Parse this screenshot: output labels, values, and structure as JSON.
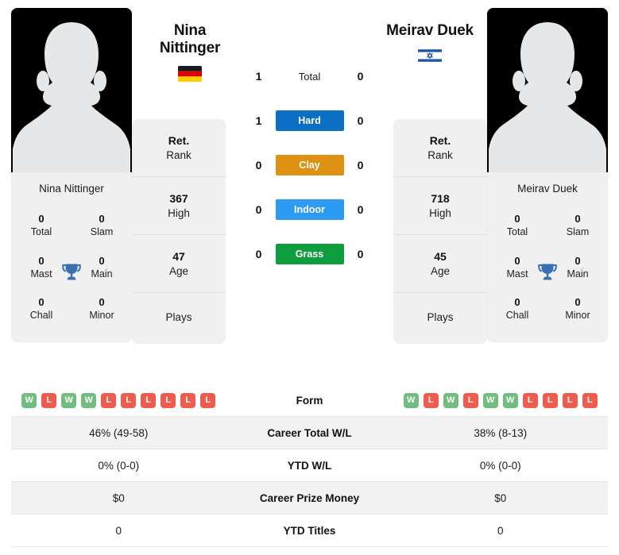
{
  "players": {
    "left": {
      "name_line1": "Nina",
      "name_line2": "Nittinger",
      "full_name": "Nina Nittinger",
      "country": "Germany",
      "flag_icon": "flag-germany",
      "rank": "Ret.",
      "rank_label": "Rank",
      "high": "367",
      "high_label": "High",
      "age": "47",
      "age_label": "Age",
      "plays": "Plays",
      "titles": {
        "total": "0",
        "total_label": "Total",
        "slam": "0",
        "slam_label": "Slam",
        "mast": "0",
        "mast_label": "Mast",
        "main": "0",
        "main_label": "Main",
        "chall": "0",
        "chall_label": "Chall",
        "minor": "0",
        "minor_label": "Minor"
      },
      "form": [
        "W",
        "L",
        "W",
        "W",
        "L",
        "L",
        "L",
        "L",
        "L",
        "L"
      ],
      "career_total_wl": "46% (49-58)",
      "ytd_wl": "0% (0-0)",
      "career_prize_money": "$0",
      "ytd_titles": "0",
      "surface_scores": {
        "total": "1",
        "hard": "1",
        "clay": "0",
        "indoor": "0",
        "grass": "0"
      }
    },
    "right": {
      "name_line1": "Meirav Duek",
      "name_line2": "",
      "full_name": "Meirav Duek",
      "country": "Israel",
      "flag_icon": "flag-israel",
      "rank": "Ret.",
      "rank_label": "Rank",
      "high": "718",
      "high_label": "High",
      "age": "45",
      "age_label": "Age",
      "plays": "Plays",
      "titles": {
        "total": "0",
        "total_label": "Total",
        "slam": "0",
        "slam_label": "Slam",
        "mast": "0",
        "mast_label": "Mast",
        "main": "0",
        "main_label": "Main",
        "chall": "0",
        "chall_label": "Chall",
        "minor": "0",
        "minor_label": "Minor"
      },
      "form": [
        "W",
        "L",
        "W",
        "L",
        "W",
        "W",
        "L",
        "L",
        "L",
        "L"
      ],
      "career_total_wl": "38% (8-13)",
      "ytd_wl": "0% (0-0)",
      "career_prize_money": "$0",
      "ytd_titles": "0",
      "surface_scores": {
        "total": "0",
        "hard": "0",
        "clay": "0",
        "indoor": "0",
        "grass": "0"
      }
    }
  },
  "surfaces": [
    {
      "key": "total",
      "label": "Total",
      "color": "transparent",
      "plain": true
    },
    {
      "key": "hard",
      "label": "Hard",
      "color": "#0d6fc4",
      "plain": false
    },
    {
      "key": "clay",
      "label": "Clay",
      "color": "#df9113",
      "plain": false
    },
    {
      "key": "indoor",
      "label": "Indoor",
      "color": "#2b9bf4",
      "plain": false
    },
    {
      "key": "grass",
      "label": "Grass",
      "color": "#0e9e3e",
      "plain": false
    }
  ],
  "table_rows": [
    {
      "label": "Form"
    },
    {
      "label": "Career Total W/L"
    },
    {
      "label": "YTD W/L"
    },
    {
      "label": "Career Prize Money"
    },
    {
      "label": "YTD Titles"
    }
  ],
  "colors": {
    "win_badge": "#6fbd7f",
    "loss_badge": "#ef5b4c",
    "panel": "#f0f0f0",
    "row_alt": "#f2f2f2",
    "trophy": "#3a6fb0"
  }
}
